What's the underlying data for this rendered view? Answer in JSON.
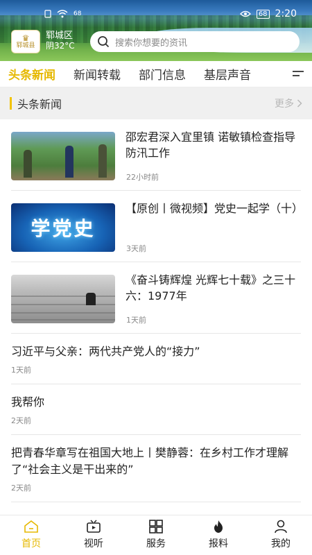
{
  "status_bar": {
    "signal_text": "68",
    "time": "2:20",
    "battery": "68"
  },
  "header": {
    "logo_text": "郓城县",
    "weather_location": "郓城区",
    "weather_desc": "阴32°C",
    "search_placeholder": "搜索你想要的资讯"
  },
  "tabs": [
    {
      "label": "头条新闻",
      "active": true
    },
    {
      "label": "新闻转载",
      "active": false
    },
    {
      "label": "部门信息",
      "active": false
    },
    {
      "label": "基层声音",
      "active": false
    }
  ],
  "section": {
    "title": "头条新闻",
    "more_label": "更多"
  },
  "news": [
    {
      "title": "邵宏君深入宜里镇 诺敏镇检查指导防汛工作",
      "time": "22小时前"
    },
    {
      "title": "【原创丨微视频】党史一起学（十）",
      "time": "3天前",
      "thumb_text": "学党史"
    },
    {
      "title": "《奋斗铸辉煌 光辉七十载》之三十六：1977年",
      "time": "1天前"
    },
    {
      "title": "习近平与父亲：两代共产党人的“接力”",
      "time": "1天前"
    },
    {
      "title": "我帮你",
      "time": "2天前"
    },
    {
      "title": "把青春华章写在祖国大地上丨樊静蓉：在乡村工作才理解了“社会主义是干出来的”",
      "time": "2天前"
    }
  ],
  "bottom_nav": [
    {
      "label": "首页",
      "icon": "home-icon",
      "active": true
    },
    {
      "label": "视听",
      "icon": "video-icon",
      "active": false
    },
    {
      "label": "服务",
      "icon": "grid-icon",
      "active": false
    },
    {
      "label": "报料",
      "icon": "fire-icon",
      "active": false
    },
    {
      "label": "我的",
      "icon": "user-icon",
      "active": false
    }
  ],
  "colors": {
    "accent": "#e6b800",
    "section_bar": "#f2c300"
  }
}
